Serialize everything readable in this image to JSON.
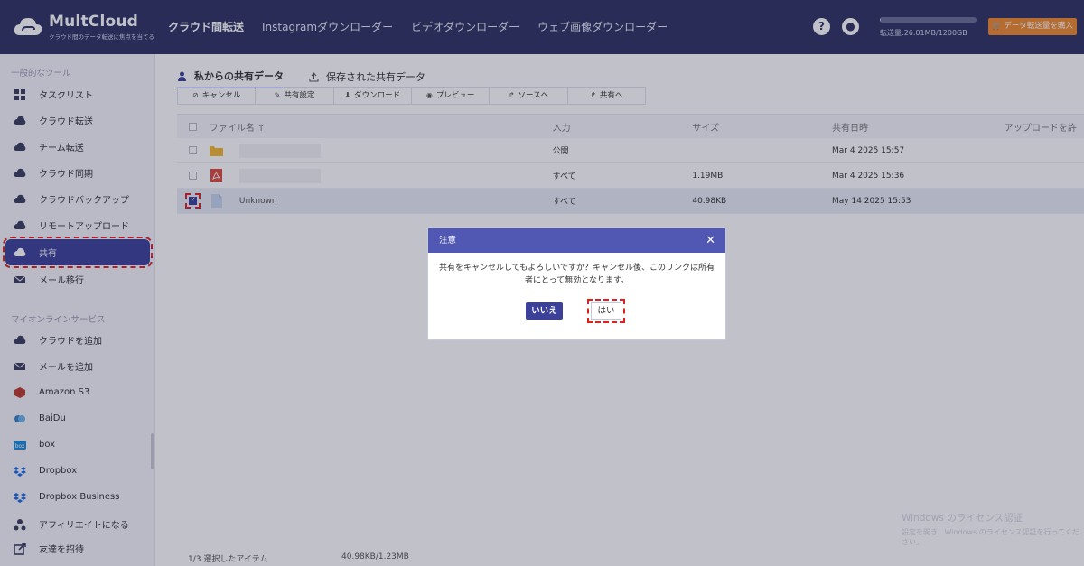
{
  "header": {
    "logo_title": "MultCloud",
    "logo_subtitle": "クラウド間のデータ転送に焦点を当てる",
    "nav": [
      "クラウド間転送",
      "Instagramダウンローダー",
      "ビデオダウンローダー",
      "ウェブ画像ダウンローダー"
    ],
    "traffic_text": "転送量:26.01MB/1200GB",
    "traffic_used_fraction": 0.0,
    "buy_button": "データ転送量を購入",
    "help_icon": "help-icon",
    "user_icon": "user-icon"
  },
  "sidebar": {
    "section1": "一般的なツール",
    "tools": [
      {
        "label": "タスクリスト",
        "icon": "grid-icon"
      },
      {
        "label": "クラウド転送",
        "icon": "cloud-transfer-icon"
      },
      {
        "label": "チーム転送",
        "icon": "team-transfer-icon"
      },
      {
        "label": "クラウド同期",
        "icon": "cloud-sync-icon"
      },
      {
        "label": "クラウドバックアップ",
        "icon": "cloud-backup-icon"
      },
      {
        "label": "リモートアップロード",
        "icon": "remote-upload-icon"
      },
      {
        "label": "共有",
        "icon": "share-icon"
      },
      {
        "label": "メール移行",
        "icon": "mail-migration-icon"
      }
    ],
    "section2": "マイオンラインサービス",
    "services": [
      {
        "label": "クラウドを追加",
        "icon": "add-cloud-icon"
      },
      {
        "label": "メールを追加",
        "icon": "add-mail-icon"
      },
      {
        "label": "Amazon S3",
        "icon": "amazon-s3-icon"
      },
      {
        "label": "BaiDu",
        "icon": "baidu-icon"
      },
      {
        "label": "box",
        "icon": "box-icon"
      },
      {
        "label": "Dropbox",
        "icon": "dropbox-icon"
      },
      {
        "label": "Dropbox Business",
        "icon": "dropbox-business-icon"
      },
      {
        "label": "アフィリエイトになる",
        "icon": "affiliate-icon"
      },
      {
        "label": "友達を招待",
        "icon": "invite-icon"
      }
    ]
  },
  "main": {
    "tabs": [
      "私からの共有データ",
      "保存された共有データ"
    ],
    "toolbar": [
      {
        "label": "キャンセル",
        "glyph": "⊘"
      },
      {
        "label": "共有設定",
        "glyph": "✎"
      },
      {
        "label": "ダウンロード",
        "glyph": "⬇"
      },
      {
        "label": "プレビュー",
        "glyph": "◉"
      },
      {
        "label": "ソースへ",
        "glyph": "↱"
      },
      {
        "label": "共有へ",
        "glyph": "↱"
      }
    ],
    "columns": [
      "ファイル名 ↑",
      "入力",
      "サイズ",
      "共有日時",
      "アップロードを許"
    ],
    "rows": [
      {
        "name": "",
        "type": "folder",
        "input": "公開",
        "size": "",
        "date": "Mar 4 2025 15:57",
        "selected": false
      },
      {
        "name": "",
        "type": "pdf",
        "input": "すべて",
        "size": "1.19MB",
        "date": "Mar 4 2025 15:36",
        "selected": false
      },
      {
        "name": "Unknown",
        "type": "file",
        "input": "すべて",
        "size": "40.98KB",
        "date": "May 14 2025 15:53",
        "selected": true
      }
    ],
    "status_selected": "1/3 選択したアイテム",
    "status_size": "40.98KB/1.23MB"
  },
  "watermark": {
    "line1": "Windows のライセンス認証",
    "line2": "設定を開き、Windows のライセンス認証を行ってください。"
  },
  "dialog": {
    "title": "注意",
    "message": "共有をキャンセルしてもよろしいですか？キャンセル後、このリンクは所有者にとって無効となります。",
    "no_label": "いいえ",
    "yes_label": "はい"
  },
  "colors": {
    "header_bg": "#2d3161",
    "accent": "#3b4099",
    "dialog_header": "#5058b3",
    "buy_button": "#f08a2b",
    "highlight": "#e02020"
  }
}
